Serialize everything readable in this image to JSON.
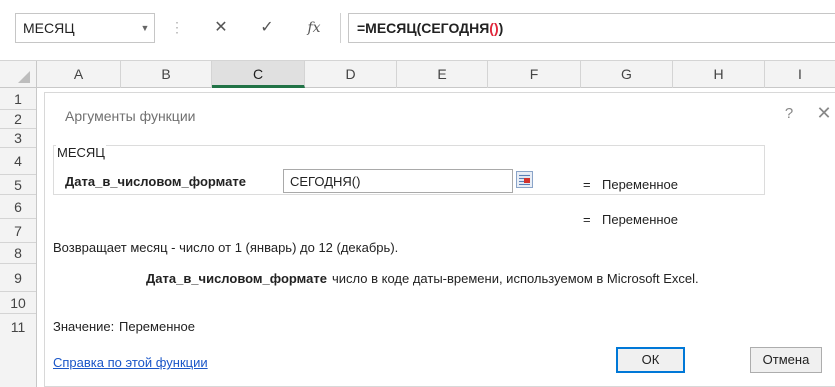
{
  "formula_bar": {
    "name_box": "МЕСЯЦ",
    "separator": "⋮",
    "cancel_glyph": "✕",
    "enter_glyph": "✓",
    "fx_label": "fx",
    "formula_main": "=МЕСЯЦ(СЕГОДНЯ",
    "formula_paren": "()",
    "formula_close": ")"
  },
  "columns": [
    "A",
    "B",
    "C",
    "D",
    "E",
    "F",
    "G",
    "H",
    "I"
  ],
  "selected_column": "C",
  "rows": [
    "1",
    "2",
    "3",
    "4",
    "5",
    "6",
    "7",
    "8",
    "9",
    "10",
    "11"
  ],
  "dialog": {
    "title": "Аргументы функции",
    "help_glyph": "?",
    "close_glyph": "✕",
    "function_name": "МЕСЯЦ",
    "arg_label": "Дата_в_числовом_формате",
    "arg_value": "СЕГОДНЯ()",
    "eq_sign": "=",
    "arg_result": "Переменное",
    "func_result": "Переменное",
    "description": "Возвращает месяц - число от 1 (январь) до 12 (декабрь).",
    "arg_desc_name": "Дата_в_числовом_формате",
    "arg_desc_text": "число в коде даты-времени, используемом в Microsoft Excel.",
    "result_label": "Значение:",
    "result_value": "Переменное",
    "help_link": "Справка по этой функции",
    "ok_label": "ОК",
    "cancel_label": "Отмена"
  },
  "colors": {
    "accent_green": "#217346",
    "paren_red": "#e0263a",
    "link_blue": "#1a56c8",
    "ok_border": "#0078d7"
  }
}
